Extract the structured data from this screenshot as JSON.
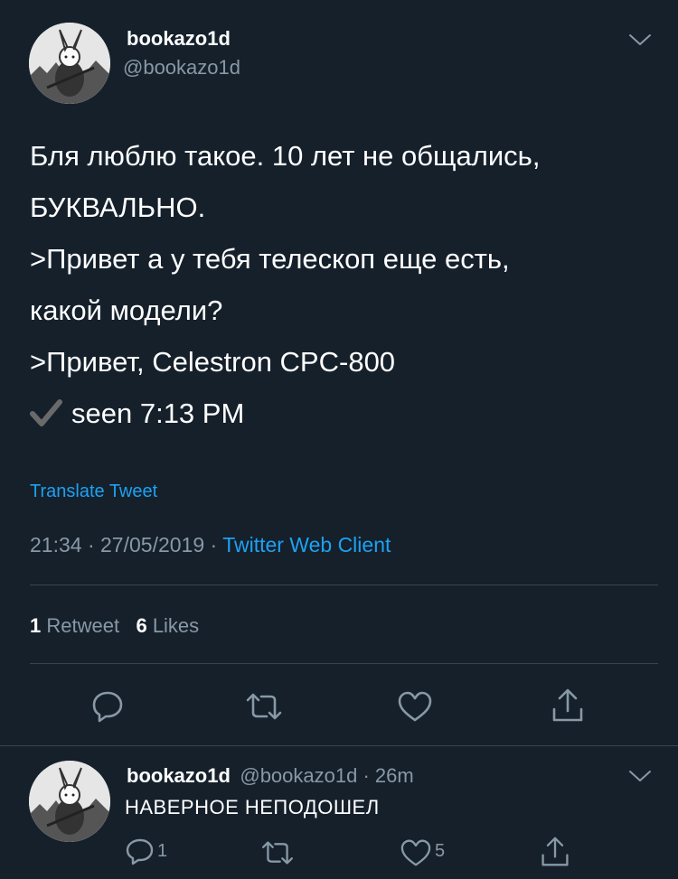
{
  "tweet": {
    "display_name": "bookazo1d",
    "handle": "@bookazo1d",
    "lines": [
      "Бля люблю такое. 10 лет не общались,",
      "БУКВАЛЬНО.",
      ">Привет а у тебя телескоп еще есть,",
      "какой модели?",
      ">Привет, Celestron CPC-800"
    ],
    "seen_text": "seen 7:13 PM",
    "translate_label": "Translate Tweet",
    "time": "21:34",
    "date": "27/05/2019",
    "separator": "·",
    "client": "Twitter Web Client",
    "retweets_count": "1",
    "retweets_label": "Retweet",
    "likes_count": "6",
    "likes_label": "Likes"
  },
  "reply": {
    "display_name": "bookazo1d",
    "handle_time": "@bookazo1d · 26m",
    "text": "НАВЕРНОЕ НЕПОДОШЕЛ",
    "reply_count": "1",
    "like_count": "5"
  },
  "colors": {
    "background": "#15202b",
    "text_primary": "#ffffff",
    "text_secondary": "#8899a6",
    "accent": "#1da1f2",
    "divider": "#38444d"
  },
  "icons": {
    "avatar": "samurai-rabbit-avatar",
    "chevron": "chevron-down-icon",
    "reply": "reply-icon",
    "retweet": "retweet-icon",
    "like": "heart-icon",
    "share": "share-icon",
    "check": "check-icon"
  }
}
